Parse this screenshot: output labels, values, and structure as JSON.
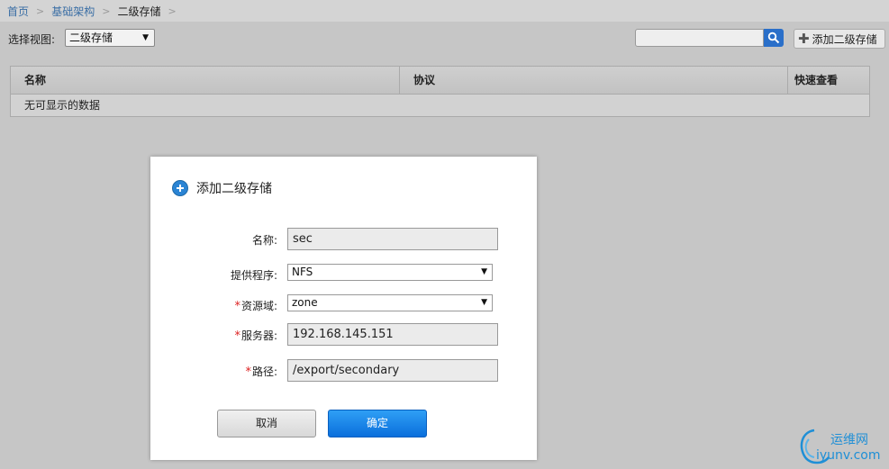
{
  "breadcrumb": {
    "home": "首页",
    "infra": "基础架构",
    "current": "二级存储",
    "sep": ">"
  },
  "toolbar": {
    "view_label": "选择视图:",
    "view_value": "二级存储",
    "search_value": "",
    "add_label": "添加二级存储"
  },
  "grid": {
    "columns": [
      "名称",
      "协议",
      "快速查看"
    ],
    "empty_text": "无可显示的数据"
  },
  "dialog": {
    "title": "添加二级存储",
    "fields": {
      "name": {
        "label": "名称:",
        "value": "sec"
      },
      "provider": {
        "label": "提供程序:",
        "value": "NFS"
      },
      "zone": {
        "label": "资源域:",
        "value": "zone",
        "required": true
      },
      "server": {
        "label": "服务器:",
        "value": "192.168.145.151",
        "required": true
      },
      "path": {
        "label": "路径:",
        "value": "/export/secondary",
        "required": true
      }
    },
    "required_mark": "*",
    "cancel_label": "取消",
    "ok_label": "确定"
  },
  "watermark": {
    "cn": "运维网",
    "en": "iyunv.com"
  },
  "colors": {
    "accent": "#2a6fc9",
    "ok_button": "#0a6fdc",
    "required": "#dd2222"
  },
  "icons": [
    "search-icon",
    "plus-icon",
    "add-circle-icon",
    "chevron-down-icon"
  ]
}
